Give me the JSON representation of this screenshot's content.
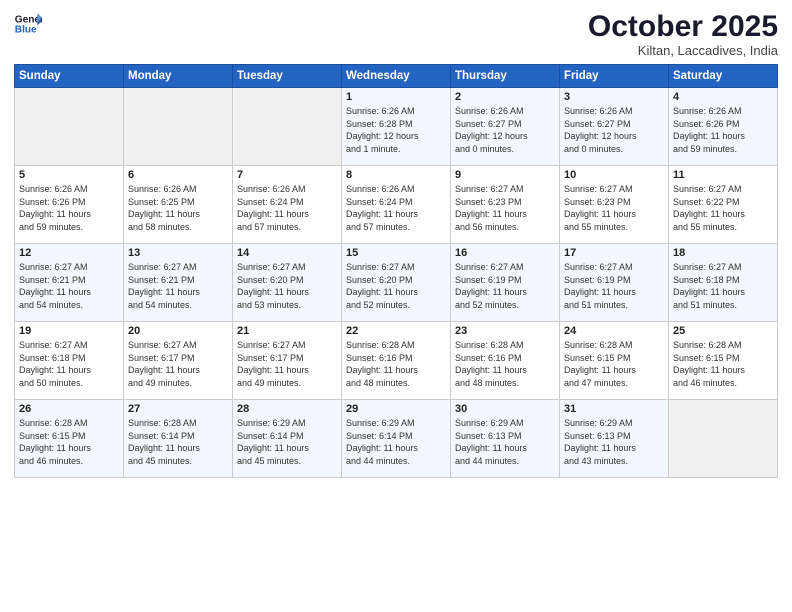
{
  "header": {
    "logo_line1": "General",
    "logo_line2": "Blue",
    "month": "October 2025",
    "location": "Kiltan, Laccadives, India"
  },
  "days_of_week": [
    "Sunday",
    "Monday",
    "Tuesday",
    "Wednesday",
    "Thursday",
    "Friday",
    "Saturday"
  ],
  "weeks": [
    [
      {
        "day": "",
        "text": ""
      },
      {
        "day": "",
        "text": ""
      },
      {
        "day": "",
        "text": ""
      },
      {
        "day": "1",
        "text": "Sunrise: 6:26 AM\nSunset: 6:28 PM\nDaylight: 12 hours\nand 1 minute."
      },
      {
        "day": "2",
        "text": "Sunrise: 6:26 AM\nSunset: 6:27 PM\nDaylight: 12 hours\nand 0 minutes."
      },
      {
        "day": "3",
        "text": "Sunrise: 6:26 AM\nSunset: 6:27 PM\nDaylight: 12 hours\nand 0 minutes."
      },
      {
        "day": "4",
        "text": "Sunrise: 6:26 AM\nSunset: 6:26 PM\nDaylight: 11 hours\nand 59 minutes."
      }
    ],
    [
      {
        "day": "5",
        "text": "Sunrise: 6:26 AM\nSunset: 6:26 PM\nDaylight: 11 hours\nand 59 minutes."
      },
      {
        "day": "6",
        "text": "Sunrise: 6:26 AM\nSunset: 6:25 PM\nDaylight: 11 hours\nand 58 minutes."
      },
      {
        "day": "7",
        "text": "Sunrise: 6:26 AM\nSunset: 6:24 PM\nDaylight: 11 hours\nand 57 minutes."
      },
      {
        "day": "8",
        "text": "Sunrise: 6:26 AM\nSunset: 6:24 PM\nDaylight: 11 hours\nand 57 minutes."
      },
      {
        "day": "9",
        "text": "Sunrise: 6:27 AM\nSunset: 6:23 PM\nDaylight: 11 hours\nand 56 minutes."
      },
      {
        "day": "10",
        "text": "Sunrise: 6:27 AM\nSunset: 6:23 PM\nDaylight: 11 hours\nand 55 minutes."
      },
      {
        "day": "11",
        "text": "Sunrise: 6:27 AM\nSunset: 6:22 PM\nDaylight: 11 hours\nand 55 minutes."
      }
    ],
    [
      {
        "day": "12",
        "text": "Sunrise: 6:27 AM\nSunset: 6:21 PM\nDaylight: 11 hours\nand 54 minutes."
      },
      {
        "day": "13",
        "text": "Sunrise: 6:27 AM\nSunset: 6:21 PM\nDaylight: 11 hours\nand 54 minutes."
      },
      {
        "day": "14",
        "text": "Sunrise: 6:27 AM\nSunset: 6:20 PM\nDaylight: 11 hours\nand 53 minutes."
      },
      {
        "day": "15",
        "text": "Sunrise: 6:27 AM\nSunset: 6:20 PM\nDaylight: 11 hours\nand 52 minutes."
      },
      {
        "day": "16",
        "text": "Sunrise: 6:27 AM\nSunset: 6:19 PM\nDaylight: 11 hours\nand 52 minutes."
      },
      {
        "day": "17",
        "text": "Sunrise: 6:27 AM\nSunset: 6:19 PM\nDaylight: 11 hours\nand 51 minutes."
      },
      {
        "day": "18",
        "text": "Sunrise: 6:27 AM\nSunset: 6:18 PM\nDaylight: 11 hours\nand 51 minutes."
      }
    ],
    [
      {
        "day": "19",
        "text": "Sunrise: 6:27 AM\nSunset: 6:18 PM\nDaylight: 11 hours\nand 50 minutes."
      },
      {
        "day": "20",
        "text": "Sunrise: 6:27 AM\nSunset: 6:17 PM\nDaylight: 11 hours\nand 49 minutes."
      },
      {
        "day": "21",
        "text": "Sunrise: 6:27 AM\nSunset: 6:17 PM\nDaylight: 11 hours\nand 49 minutes."
      },
      {
        "day": "22",
        "text": "Sunrise: 6:28 AM\nSunset: 6:16 PM\nDaylight: 11 hours\nand 48 minutes."
      },
      {
        "day": "23",
        "text": "Sunrise: 6:28 AM\nSunset: 6:16 PM\nDaylight: 11 hours\nand 48 minutes."
      },
      {
        "day": "24",
        "text": "Sunrise: 6:28 AM\nSunset: 6:15 PM\nDaylight: 11 hours\nand 47 minutes."
      },
      {
        "day": "25",
        "text": "Sunrise: 6:28 AM\nSunset: 6:15 PM\nDaylight: 11 hours\nand 46 minutes."
      }
    ],
    [
      {
        "day": "26",
        "text": "Sunrise: 6:28 AM\nSunset: 6:15 PM\nDaylight: 11 hours\nand 46 minutes."
      },
      {
        "day": "27",
        "text": "Sunrise: 6:28 AM\nSunset: 6:14 PM\nDaylight: 11 hours\nand 45 minutes."
      },
      {
        "day": "28",
        "text": "Sunrise: 6:29 AM\nSunset: 6:14 PM\nDaylight: 11 hours\nand 45 minutes."
      },
      {
        "day": "29",
        "text": "Sunrise: 6:29 AM\nSunset: 6:14 PM\nDaylight: 11 hours\nand 44 minutes."
      },
      {
        "day": "30",
        "text": "Sunrise: 6:29 AM\nSunset: 6:13 PM\nDaylight: 11 hours\nand 44 minutes."
      },
      {
        "day": "31",
        "text": "Sunrise: 6:29 AM\nSunset: 6:13 PM\nDaylight: 11 hours\nand 43 minutes."
      },
      {
        "day": "",
        "text": ""
      }
    ]
  ]
}
